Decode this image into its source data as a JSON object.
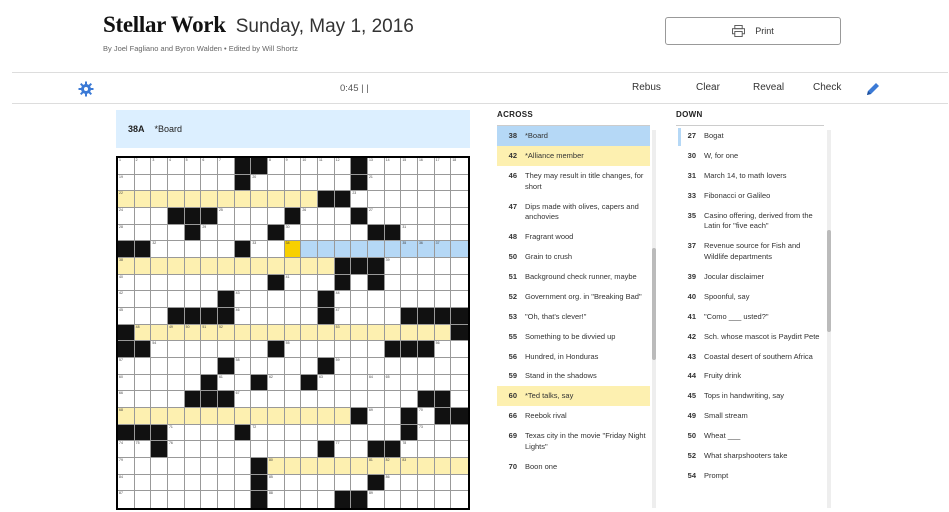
{
  "header": {
    "title": "Stellar Work",
    "date": "Sunday, May 1, 2016",
    "byline": "By Joel Fagliano and Byron Walden • Edited by Will Shortz"
  },
  "print": {
    "label": "Print",
    "icon": "printer-icon"
  },
  "toolbar": {
    "timer": "0:45  | |",
    "rebus": "Rebus",
    "clear": "Clear",
    "reveal": "Reveal",
    "check": "Check",
    "accent_color": "#3b7ad6"
  },
  "clue_bar": {
    "num": "38A",
    "text": "*Board"
  },
  "across": {
    "heading": "ACROSS",
    "clues": [
      {
        "num": "38",
        "text": "*Board",
        "state": "act"
      },
      {
        "num": "42",
        "text": "*Alliance member",
        "state": "hl"
      },
      {
        "num": "46",
        "text": "They may result in title changes, for short",
        "state": ""
      },
      {
        "num": "47",
        "text": "Dips made with olives, capers and anchovies",
        "state": ""
      },
      {
        "num": "48",
        "text": "Fragrant wood",
        "state": ""
      },
      {
        "num": "50",
        "text": "Grain to crush",
        "state": ""
      },
      {
        "num": "51",
        "text": "Background check runner, maybe",
        "state": ""
      },
      {
        "num": "52",
        "text": "Government org. in \"Breaking Bad\"",
        "state": ""
      },
      {
        "num": "53",
        "text": "\"Oh, that's clever!\"",
        "state": ""
      },
      {
        "num": "55",
        "text": "Something to be divvied up",
        "state": ""
      },
      {
        "num": "56",
        "text": "Hundred, in Honduras",
        "state": ""
      },
      {
        "num": "59",
        "text": "Stand in the shadows",
        "state": ""
      },
      {
        "num": "60",
        "text": "*Ted talks, say",
        "state": "hl"
      },
      {
        "num": "66",
        "text": "Reebok rival",
        "state": ""
      },
      {
        "num": "69",
        "text": "Texas city in the movie \"Friday Night Lights\"",
        "state": ""
      },
      {
        "num": "70",
        "text": "Boon one",
        "state": ""
      }
    ]
  },
  "down": {
    "heading": "DOWN",
    "clues": [
      {
        "num": "27",
        "text": "Bogat"
      },
      {
        "num": "30",
        "text": "W, for one"
      },
      {
        "num": "31",
        "text": "March 14, to math lovers"
      },
      {
        "num": "33",
        "text": "Fibonacci or Galileo"
      },
      {
        "num": "35",
        "text": "Casino offering, derived from the Latin for \"five each\""
      },
      {
        "num": "37",
        "text": "Revenue source for Fish and Wildlife departments"
      },
      {
        "num": "39",
        "text": "Jocular disclaimer"
      },
      {
        "num": "40",
        "text": "Spoonful, say"
      },
      {
        "num": "41",
        "text": "\"Como ___ usted?\""
      },
      {
        "num": "42",
        "text": "Sch. whose mascot is Paydirt Pete"
      },
      {
        "num": "43",
        "text": "Coastal desert of southern Africa"
      },
      {
        "num": "44",
        "text": "Fruity drink"
      },
      {
        "num": "45",
        "text": "Tops in handwriting, say"
      },
      {
        "num": "49",
        "text": "Small stream"
      },
      {
        "num": "50",
        "text": "Wheat ___"
      },
      {
        "num": "52",
        "text": "What sharpshooters take"
      },
      {
        "num": "54",
        "text": "Prompt"
      }
    ]
  },
  "grid": {
    "rows": [
      ".......##.....#......",
      ".......#......#......",
      "HHHHHHHHHHHH##.......",
      "...###....#...#......",
      "....#....#.....##....",
      "##.....#..XAAAAAAAAAA",
      "HHHHHHHHHHHHH###.....",
      ".........#...#.#.....",
      "......#.....#........",
      "...####.....#....####",
      "#HHHHHHHHHHHHHHHHHHH#",
      "##.......#......###..",
      "......#.....#........",
      ".....#..#..#.........",
      "....###...........##.",
      "HHHHHHHHHHHHHH#..#.##",
      "###....#.........#...",
      "..#.........#..##....",
      "........#HHHHHHHHHHHH",
      "........#......#.....",
      "........#....##......"
    ],
    "numbered_cells": [
      [
        0,
        0,
        "1"
      ],
      [
        0,
        1,
        "2"
      ],
      [
        0,
        2,
        "3"
      ],
      [
        0,
        3,
        "4"
      ],
      [
        0,
        4,
        "5"
      ],
      [
        0,
        5,
        "6"
      ],
      [
        0,
        6,
        "7"
      ],
      [
        0,
        9,
        "8"
      ],
      [
        0,
        10,
        "9"
      ],
      [
        0,
        11,
        "10"
      ],
      [
        0,
        12,
        "11"
      ],
      [
        0,
        13,
        "12"
      ],
      [
        0,
        15,
        "13"
      ],
      [
        0,
        16,
        "14"
      ],
      [
        0,
        17,
        "15"
      ],
      [
        0,
        18,
        "16"
      ],
      [
        0,
        19,
        "17"
      ],
      [
        0,
        20,
        "18"
      ],
      [
        1,
        0,
        "19"
      ],
      [
        1,
        8,
        "20"
      ],
      [
        1,
        15,
        "21"
      ],
      [
        2,
        0,
        "22"
      ],
      [
        2,
        14,
        "23"
      ],
      [
        3,
        0,
        "24"
      ],
      [
        3,
        6,
        "25"
      ],
      [
        3,
        11,
        "26"
      ],
      [
        3,
        15,
        "27"
      ],
      [
        4,
        0,
        "28"
      ],
      [
        4,
        5,
        "29"
      ],
      [
        4,
        10,
        "30"
      ],
      [
        4,
        17,
        "31"
      ],
      [
        5,
        2,
        "32"
      ],
      [
        5,
        8,
        "33"
      ],
      [
        5,
        10,
        "34"
      ],
      [
        5,
        17,
        "35"
      ],
      [
        5,
        18,
        "36"
      ],
      [
        5,
        19,
        "37"
      ],
      [
        6,
        0,
        "38"
      ],
      [
        6,
        16,
        "39"
      ],
      [
        7,
        0,
        "40"
      ],
      [
        7,
        10,
        "41"
      ],
      [
        8,
        0,
        "42"
      ],
      [
        8,
        7,
        "43"
      ],
      [
        8,
        13,
        "44"
      ],
      [
        9,
        0,
        "45"
      ],
      [
        9,
        7,
        "46"
      ],
      [
        9,
        13,
        "47"
      ],
      [
        10,
        1,
        "48"
      ],
      [
        10,
        3,
        "49"
      ],
      [
        10,
        4,
        "50"
      ],
      [
        10,
        5,
        "51"
      ],
      [
        10,
        6,
        "52"
      ],
      [
        10,
        13,
        "53"
      ],
      [
        11,
        2,
        "54"
      ],
      [
        11,
        10,
        "55"
      ],
      [
        11,
        19,
        "56"
      ],
      [
        12,
        0,
        "57"
      ],
      [
        12,
        7,
        "58"
      ],
      [
        12,
        13,
        "59"
      ],
      [
        13,
        0,
        "60"
      ],
      [
        13,
        6,
        "61"
      ],
      [
        13,
        9,
        "62"
      ],
      [
        13,
        12,
        "63"
      ],
      [
        13,
        15,
        "64"
      ],
      [
        13,
        16,
        "65"
      ],
      [
        14,
        0,
        "66"
      ],
      [
        14,
        7,
        "67"
      ],
      [
        15,
        0,
        "68"
      ],
      [
        15,
        15,
        "69"
      ],
      [
        15,
        18,
        "70"
      ],
      [
        16,
        3,
        "71"
      ],
      [
        16,
        8,
        "72"
      ],
      [
        16,
        18,
        "73"
      ],
      [
        17,
        0,
        "74"
      ],
      [
        17,
        1,
        "75"
      ],
      [
        17,
        3,
        "76"
      ],
      [
        17,
        13,
        "77"
      ],
      [
        17,
        17,
        "78"
      ],
      [
        18,
        0,
        "79"
      ],
      [
        18,
        9,
        "80"
      ],
      [
        18,
        15,
        "81"
      ],
      [
        18,
        16,
        "82"
      ],
      [
        18,
        17,
        "83"
      ],
      [
        19,
        0,
        "84"
      ],
      [
        19,
        9,
        "85"
      ],
      [
        19,
        16,
        "86"
      ],
      [
        20,
        0,
        "87"
      ],
      [
        20,
        9,
        "88"
      ],
      [
        20,
        15,
        "89"
      ]
    ]
  }
}
